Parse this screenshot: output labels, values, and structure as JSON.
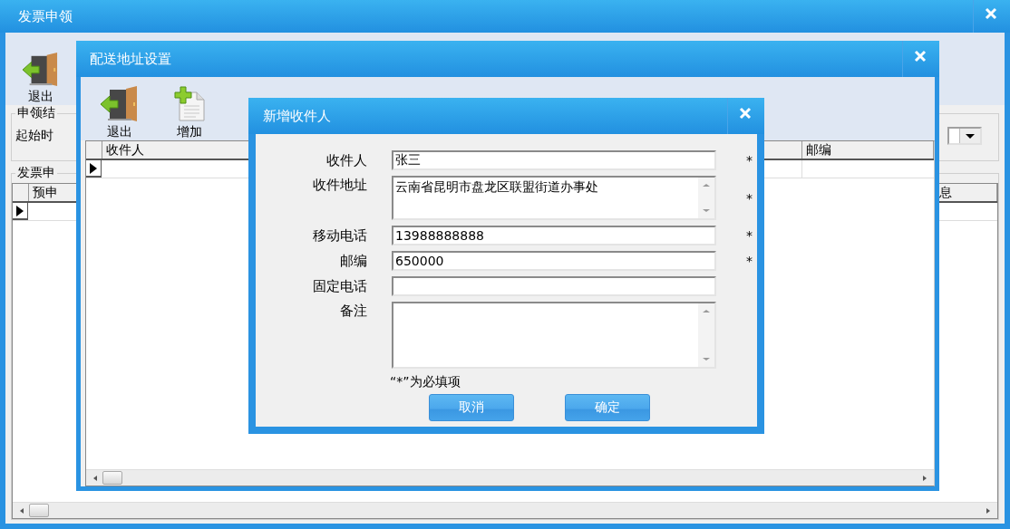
{
  "main_window": {
    "title": "发票申领",
    "toolbar": [
      {
        "kind": "exit",
        "label": "退出"
      }
    ],
    "result_group": {
      "title": "申领结",
      "start_time_label": "起始时"
    },
    "invoice_group": {
      "title": "发票申",
      "columns": [
        {
          "label": "预申"
        },
        {
          "label": "息"
        }
      ]
    }
  },
  "address_window": {
    "title": "配送地址设置",
    "toolbar": [
      {
        "kind": "exit",
        "label": "退出"
      },
      {
        "kind": "add",
        "label": "增加"
      }
    ],
    "columns": [
      {
        "label": "收件人"
      },
      {
        "label": "邮编"
      }
    ]
  },
  "dialog": {
    "title": "新增收件人",
    "required_mark": "*",
    "fields": [
      {
        "kind": "line",
        "label": "收件人",
        "value": "张三",
        "required": true
      },
      {
        "kind": "textarea",
        "label": "收件地址",
        "value": "云南省昆明市盘龙区联盟街道办事处",
        "required": true
      },
      {
        "kind": "line",
        "label": "移动电话",
        "value": "13988888888",
        "required": true
      },
      {
        "kind": "line",
        "label": "邮编",
        "value": "650000",
        "required": true
      },
      {
        "kind": "line",
        "label": "固定电话",
        "required": false
      },
      {
        "kind": "textarea_tall",
        "label": "备注",
        "required": false
      }
    ],
    "note": "“*”为必填项",
    "buttons": [
      {
        "label": "取消"
      },
      {
        "label": "确定"
      }
    ]
  }
}
